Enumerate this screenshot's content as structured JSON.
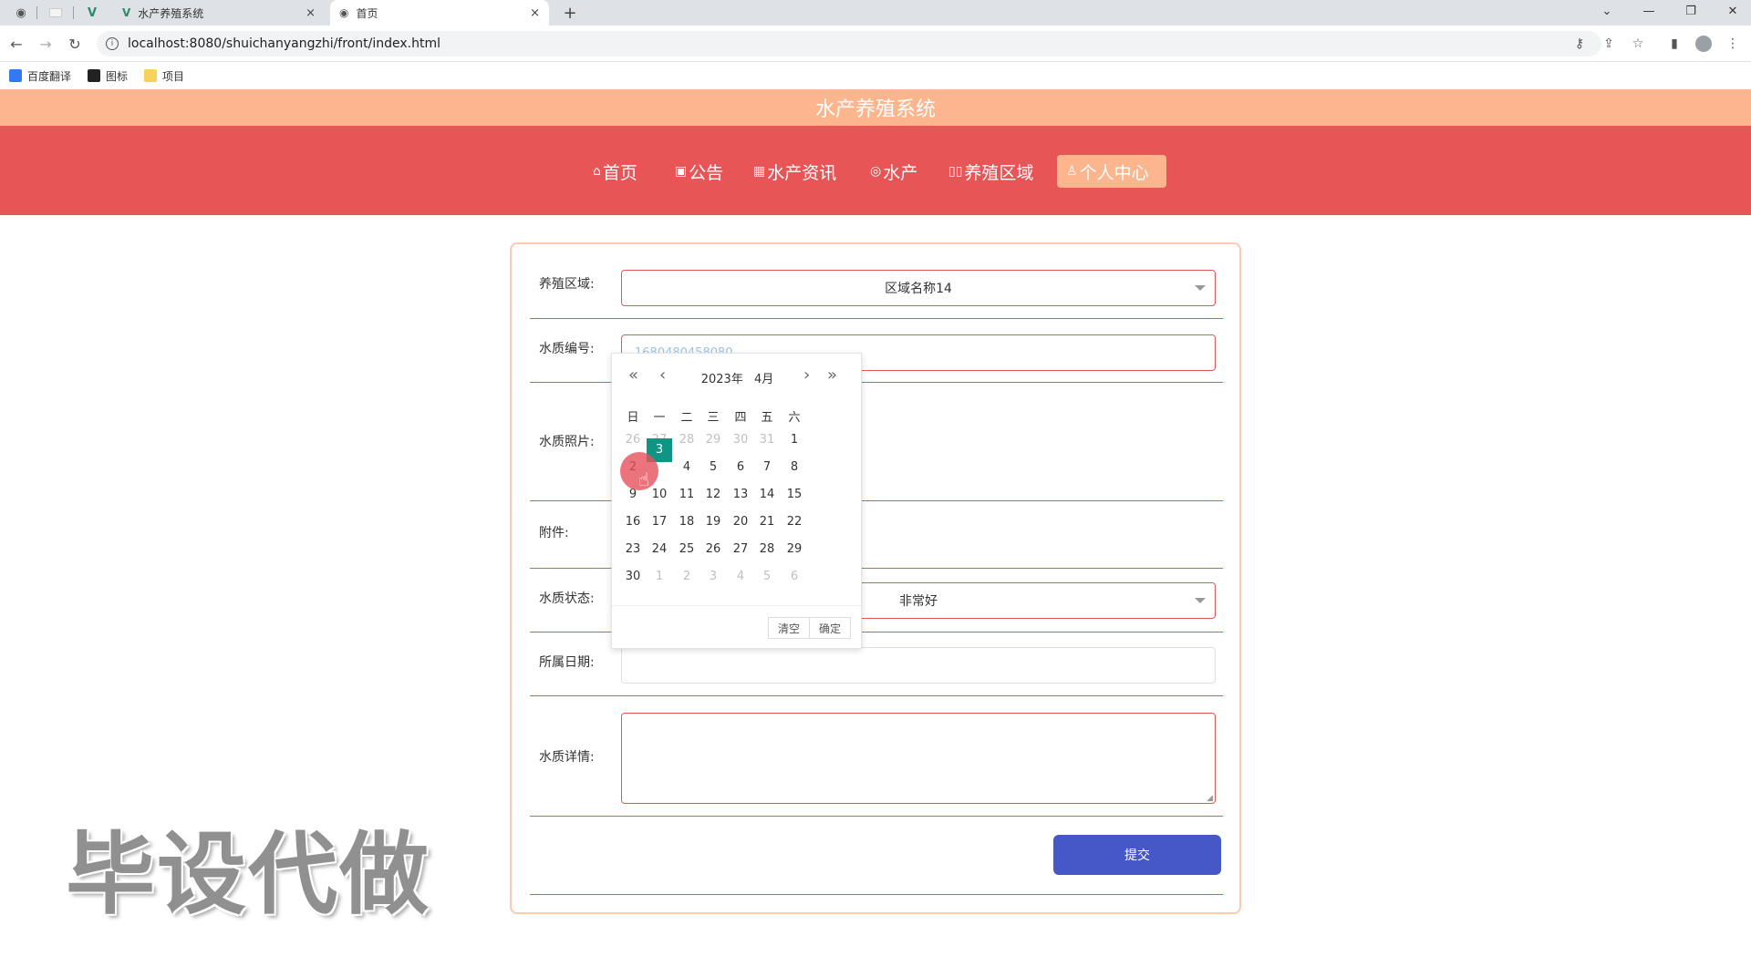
{
  "browser": {
    "tabs": [
      {
        "title": "水产养殖系统"
      },
      {
        "title": "首页"
      }
    ],
    "tab_close_glyph": "×",
    "new_tab_glyph": "+",
    "url": "localhost:8080/shuichanyangzhi/front/index.html",
    "bookmarks": [
      "百度翻译",
      "图标",
      "项目"
    ]
  },
  "site": {
    "title": "水产养殖系统",
    "nav": [
      {
        "label": "首页",
        "icon": "home-icon"
      },
      {
        "label": "公告",
        "icon": "gift-icon"
      },
      {
        "label": "水产资讯",
        "icon": "grid-icon"
      },
      {
        "label": "水产",
        "icon": "target-icon"
      },
      {
        "label": "养殖区域",
        "icon": "book-icon"
      },
      {
        "label": "个人中心",
        "icon": "user-icon"
      }
    ],
    "active_nav": "个人中心"
  },
  "form": {
    "area": {
      "label": "养殖区域:",
      "value": "区域名称14"
    },
    "code": {
      "label": "水质编号:",
      "value": "1680480458080"
    },
    "photo": {
      "label": "水质照片:"
    },
    "attachment": {
      "label": "附件:"
    },
    "status": {
      "label": "水质状态:",
      "value": "非常好"
    },
    "date": {
      "label": "所属日期:",
      "value": ""
    },
    "detail": {
      "label": "水质详情:",
      "value": ""
    },
    "submit_label": "提交"
  },
  "date_picker": {
    "year": "2023年",
    "month": "4月",
    "weekdays": [
      "日",
      "一",
      "二",
      "三",
      "四",
      "五",
      "六"
    ],
    "weeks": [
      [
        "26",
        "27",
        "28",
        "29",
        "30",
        "31",
        "1"
      ],
      [
        "2",
        "3",
        "4",
        "5",
        "6",
        "7",
        "8"
      ],
      [
        "9",
        "10",
        "11",
        "12",
        "13",
        "14",
        "15"
      ],
      [
        "16",
        "17",
        "18",
        "19",
        "20",
        "21",
        "22"
      ],
      [
        "23",
        "24",
        "25",
        "26",
        "27",
        "28",
        "29"
      ],
      [
        "30",
        "1",
        "2",
        "3",
        "4",
        "5",
        "6"
      ]
    ],
    "selected_day": "3",
    "clear_label": "清空",
    "confirm_label": "确定",
    "accent_color": "#109585"
  },
  "watermark": "毕设代做",
  "colors": {
    "title_bar": "#fdb58e",
    "nav_bar": "#e85557",
    "submit": "#4658c6",
    "attach_button": "#14a08c"
  }
}
